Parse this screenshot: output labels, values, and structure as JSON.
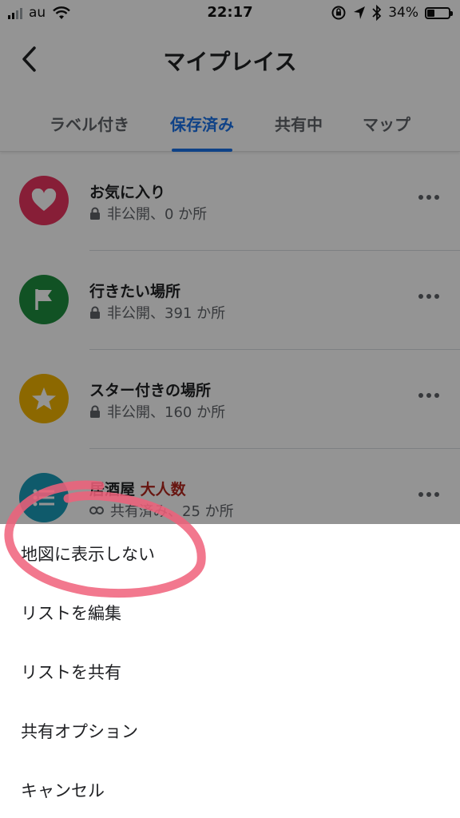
{
  "status_bar": {
    "carrier": "au",
    "time": "22:17",
    "battery_text": "34%",
    "battery_level": 0.34
  },
  "header": {
    "title": "マイプレイス",
    "back_icon": "chevron-left-icon"
  },
  "tabs": [
    {
      "label": "ラベル付き",
      "active": false
    },
    {
      "label": "保存済み",
      "active": true
    },
    {
      "label": "共有中",
      "active": false
    },
    {
      "label": "マップ",
      "active": false
    }
  ],
  "lists": [
    {
      "title": "お気に入り",
      "subtitle": "非公開、0 か所",
      "icon": "heart-icon",
      "sub_icon": "lock-icon",
      "color": "#e8345f"
    },
    {
      "title": "行きたい場所",
      "subtitle": "非公開、391 か所",
      "icon": "flag-icon",
      "sub_icon": "lock-icon",
      "color": "#1e8e3e"
    },
    {
      "title": "スター付きの場所",
      "subtitle": "非公開、160 か所",
      "icon": "star-icon",
      "sub_icon": "lock-icon",
      "color": "#f2b400"
    },
    {
      "title_part1": "居酒屋 ",
      "title_part2": "大人数",
      "subtitle": "共有済み、25 か所",
      "icon": "list-icon",
      "sub_icon": "link-icon",
      "color": "#1a9bb8",
      "title_highlight_color": "#b3261e"
    }
  ],
  "sheet": {
    "items": [
      "地図に表示しない",
      "リストを編集",
      "リストを共有",
      "共有オプション",
      "キャンセル"
    ]
  },
  "colors": {
    "accent": "#1a73e8",
    "annotation": "#f0607a"
  }
}
